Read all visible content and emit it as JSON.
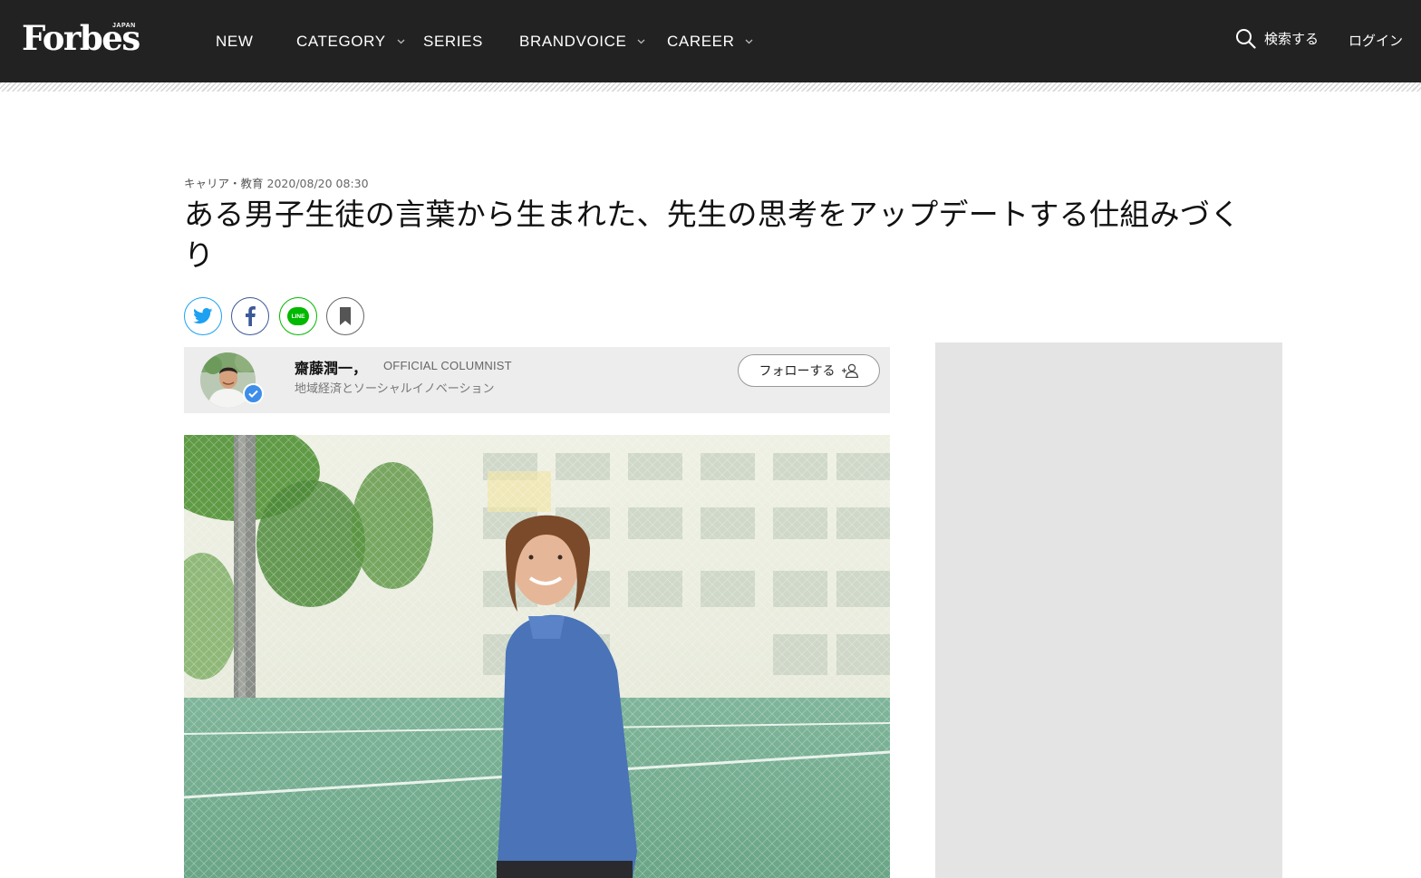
{
  "header": {
    "logo_text": "Forbes",
    "logo_sub": "JAPAN",
    "nav": [
      {
        "label": "NEW",
        "has_dropdown": false
      },
      {
        "label": "CATEGORY",
        "has_dropdown": true
      },
      {
        "label": "SERIES",
        "has_dropdown": false
      },
      {
        "label": "BRANDVOICE",
        "has_dropdown": true
      },
      {
        "label": "CAREER",
        "has_dropdown": true
      }
    ],
    "search_label": "検索する",
    "login_label": "ログイン"
  },
  "article": {
    "category": "キャリア・教育",
    "date": "2020/08/20 08:30",
    "title": "ある男子生徒の言葉から生まれた、先生の思考をアップデートする仕組みづくり"
  },
  "share": {
    "icons": [
      "twitter-icon",
      "facebook-icon",
      "line-icon",
      "bookmark-icon"
    ],
    "line_label": "LINE",
    "colors": {
      "twitter": "#1da1f2",
      "facebook": "#3b5998",
      "line": "#00b900",
      "bookmark": "#555555"
    }
  },
  "author": {
    "name": "齋藤潤一，",
    "role": "OFFICIAL COLUMNIST",
    "description": "地域経済とソーシャルイノベーション",
    "follow_label": "フォローする"
  },
  "colors": {
    "header_bg": "#222222",
    "author_bg": "#ededed",
    "ad_bg": "#e4e4e4",
    "verified": "#3d8ee8"
  }
}
